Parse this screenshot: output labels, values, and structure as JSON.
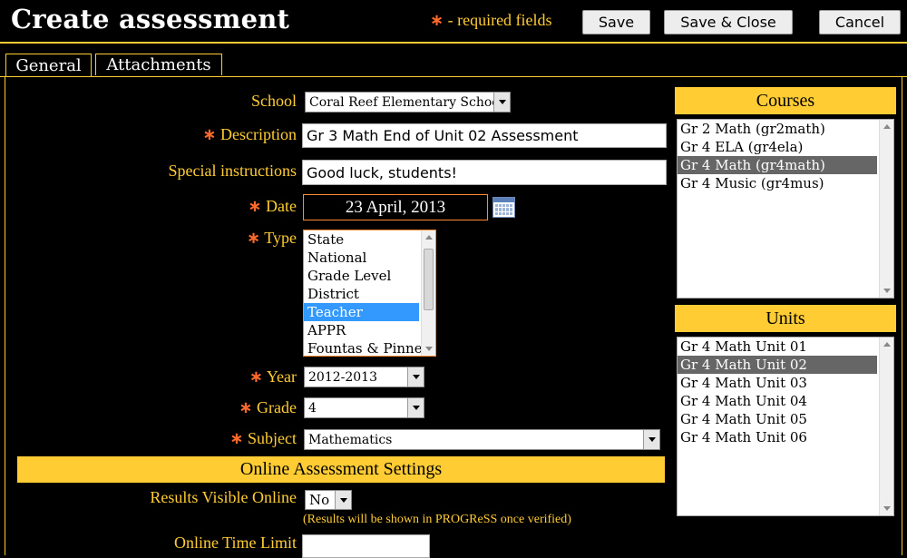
{
  "header": {
    "title": "Create assessment",
    "required_marker": "∗",
    "required_note": " - required fields",
    "buttons": {
      "save": "Save",
      "save_close": "Save & Close",
      "cancel": "Cancel"
    }
  },
  "tabs": [
    {
      "label": "General",
      "active": true
    },
    {
      "label": "Attachments",
      "active": false
    }
  ],
  "form": {
    "school": {
      "label": "School",
      "value": "Coral Reef Elementary School"
    },
    "description": {
      "label": "Description",
      "value": "Gr 3 Math End of Unit 02 Assessment"
    },
    "special_instructions": {
      "label": "Special instructions",
      "value": "Good luck, students!"
    },
    "date": {
      "label": "Date",
      "value": "23 April, 2013"
    },
    "type": {
      "label": "Type",
      "options": [
        "State",
        "National",
        "Grade Level",
        "District",
        "Teacher",
        "APPR",
        "Fountas & Pinnell"
      ],
      "selected": "Teacher"
    },
    "year": {
      "label": "Year",
      "value": "2012-2013"
    },
    "grade": {
      "label": "Grade",
      "value": "4"
    },
    "subject": {
      "label": "Subject",
      "value": "Mathematics"
    }
  },
  "online": {
    "title": "Online Assessment Settings",
    "results_visible": {
      "label": "Results Visible Online",
      "value": "No",
      "hint": "(Results will be shown in PROGReSS once verified)"
    },
    "time_limit": {
      "label": "Online Time Limit",
      "value": ""
    }
  },
  "courses": {
    "title": "Courses",
    "items": [
      "Gr 2 Math (gr2math)",
      "Gr 4 ELA (gr4ela)",
      "Gr 4 Math (gr4math)",
      "Gr 4 Music (gr4mus)"
    ],
    "selected": "Gr 4 Math (gr4math)"
  },
  "units": {
    "title": "Units",
    "items": [
      "Gr 4 Math Unit 01",
      "Gr 4 Math Unit 02",
      "Gr 4 Math Unit 03",
      "Gr 4 Math Unit 04",
      "Gr 4 Math Unit 05",
      "Gr 4 Math Unit 06"
    ],
    "selected": "Gr 4 Math Unit 02"
  },
  "colors": {
    "accent": "#ffcc33",
    "required": "#ff6a2a",
    "type_selected_bg": "#3399ff",
    "list_selected_bg": "#666666"
  }
}
